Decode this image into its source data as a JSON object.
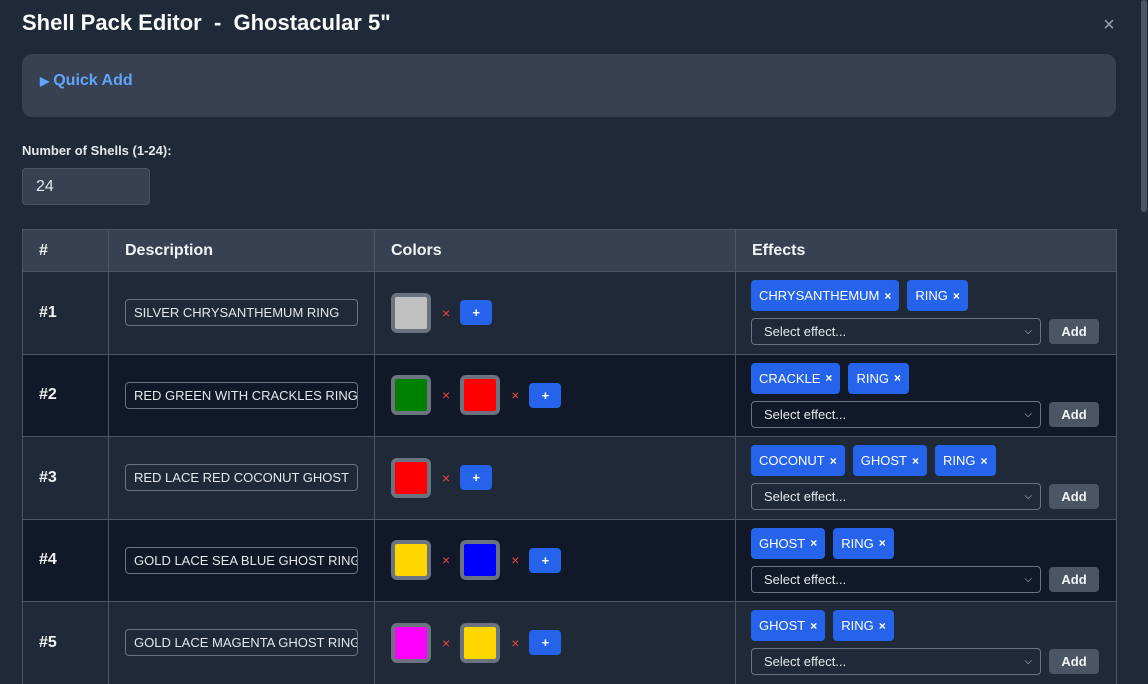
{
  "title": "Shell Pack Editor  -  Ghostacular 5\"",
  "close_label": "×",
  "quick_add": {
    "label": "Quick Add",
    "toggle_icon": "▶"
  },
  "num_shells": {
    "label": "Number of Shells (1-24):",
    "value": "24"
  },
  "table": {
    "headers": [
      "#",
      "Description",
      "Colors",
      "Effects"
    ],
    "rows": [
      {
        "index": "#1",
        "description": "SILVER CHRYSANTHEMUM RING",
        "colors": [
          "#c0c0c0"
        ],
        "effects": [
          "CHRYSANTHEMUM",
          "RING"
        ]
      },
      {
        "index": "#2",
        "description": "RED GREEN WITH CRACKLES RING",
        "colors": [
          "#008000",
          "#ff0000"
        ],
        "effects": [
          "CRACKLE",
          "RING"
        ]
      },
      {
        "index": "#3",
        "description": "RED LACE RED COCONUT GHOST",
        "colors": [
          "#ff0000"
        ],
        "effects": [
          "COCONUT",
          "GHOST",
          "RING"
        ]
      },
      {
        "index": "#4",
        "description": "GOLD LACE SEA BLUE GHOST RING",
        "colors": [
          "#ffd700",
          "#0000ff"
        ],
        "effects": [
          "GHOST",
          "RING"
        ]
      },
      {
        "index": "#5",
        "description": "GOLD LACE MAGENTA GHOST RING",
        "colors": [
          "#ff00ff",
          "#ffd700"
        ],
        "effects": [
          "GHOST",
          "RING"
        ]
      }
    ]
  },
  "color_remove_label": "×",
  "add_color_label": "+",
  "tag_remove_label": "×",
  "effect_select_placeholder": "Select effect...",
  "add_effect_label": "Add"
}
